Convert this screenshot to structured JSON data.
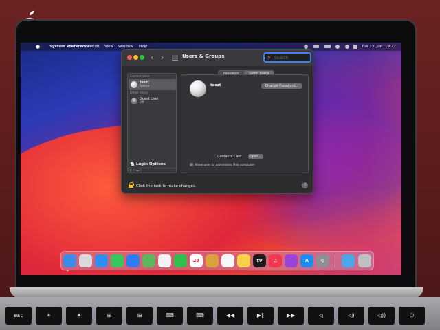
{
  "menubar": {
    "app_name": "System Preferences",
    "menus": [
      "Edit",
      "View",
      "Window",
      "Help"
    ],
    "date": "Tue 23. Jun",
    "time": "19:22"
  },
  "window": {
    "title": "Users & Groups",
    "search_placeholder": "Search",
    "tabs": [
      {
        "label": "Password",
        "active": false
      },
      {
        "label": "Login Items",
        "active": true
      }
    ],
    "sidebar": {
      "current_user_header": "Current User",
      "current_user": {
        "name": "teszt",
        "role": "Admin"
      },
      "other_users_header": "Other Users",
      "other_users": [
        {
          "name": "Guest User",
          "role": "Off"
        }
      ],
      "login_options": "Login Options",
      "add_button": "+",
      "remove_button": "−"
    },
    "detail": {
      "user_name": "teszt",
      "change_password_button": "Change Password...",
      "contacts_card_label": "Contacts Card",
      "open_button": "Open...",
      "admin_checkbox_label": "Allow user to administer this computer",
      "admin_checked": true
    },
    "lock_text": "Click the lock to make changes.",
    "help_button": "?"
  },
  "dock": {
    "apps": [
      {
        "name": "Finder",
        "icon": "finder-icon",
        "color": "#3b8ee8"
      },
      {
        "name": "Launchpad",
        "icon": "launchpad-icon",
        "color": "#d9d9d9"
      },
      {
        "name": "Safari",
        "icon": "safari-icon",
        "color": "#2f8ff0"
      },
      {
        "name": "Messages",
        "icon": "messages-icon",
        "color": "#35c759"
      },
      {
        "name": "Mail",
        "icon": "mail-icon",
        "color": "#2e7cf6"
      },
      {
        "name": "Maps",
        "icon": "maps-icon",
        "color": "#5cb85c"
      },
      {
        "name": "Photos",
        "icon": "photos-icon",
        "color": "#f2f2f2"
      },
      {
        "name": "FaceTime",
        "icon": "facetime-icon",
        "color": "#2fbf4a"
      },
      {
        "name": "Calendar",
        "icon": "calendar-icon",
        "color": "#ffffff",
        "text": "23"
      },
      {
        "name": "Contacts",
        "icon": "contacts-icon",
        "color": "#d7a33a"
      },
      {
        "name": "Reminders",
        "icon": "reminders-icon",
        "color": "#f7f7f7"
      },
      {
        "name": "Notes",
        "icon": "notes-icon",
        "color": "#f6d24a"
      },
      {
        "name": "TV",
        "icon": "tv-icon",
        "color": "#1c1c1e",
        "text": "tv"
      },
      {
        "name": "Music",
        "icon": "music-icon",
        "color": "#f2364f",
        "text": "♫"
      },
      {
        "name": "Podcasts",
        "icon": "podcasts-icon",
        "color": "#9b45d8"
      },
      {
        "name": "App Store",
        "icon": "app-store-icon",
        "color": "#1c8ef2",
        "text": "A"
      },
      {
        "name": "System Preferences",
        "icon": "system-preferences-icon",
        "color": "#8e8e93",
        "text": "⚙"
      },
      {
        "name": "Downloads",
        "icon": "folder-icon",
        "color": "#4aa8e8"
      },
      {
        "name": "Trash",
        "icon": "trash-icon",
        "color": "#bfbfbf"
      }
    ]
  },
  "keyboard": {
    "keys": [
      "esc",
      "☀",
      "☀",
      "⊞",
      "⊞",
      "⌨",
      "⌨",
      "◀◀",
      "▶‖",
      "▶▶",
      "◁",
      "◁)",
      "◁))",
      "⏻"
    ]
  }
}
